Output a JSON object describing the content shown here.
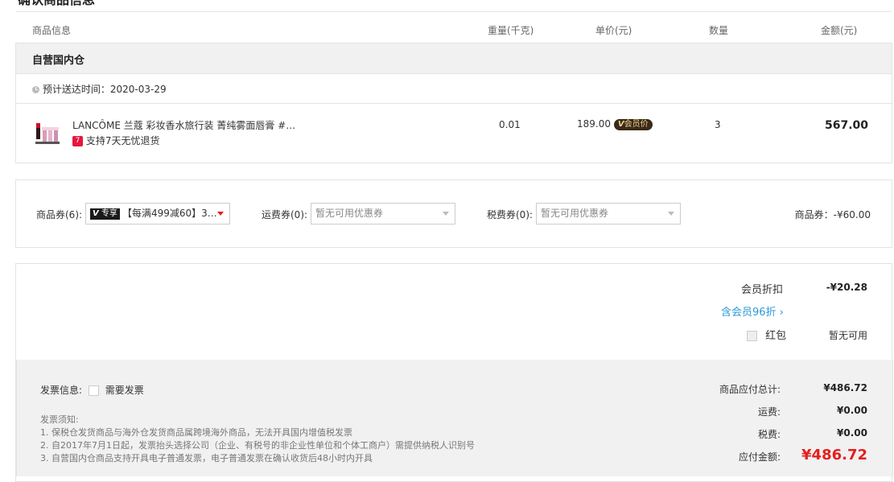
{
  "section": {
    "title": "确认商品信息"
  },
  "columns": [
    "商品信息",
    "重量(千克)",
    "单价(元)",
    "数量",
    "金额(元)"
  ],
  "warehouse": {
    "name": "自营国内仓",
    "delivery_label": "预计送达时间：",
    "delivery_date": "2020-03-29"
  },
  "item": {
    "name": "LANCÔME 兰蔻 彩妆香水旅行装 菁纯雾面唇膏 #…",
    "return_badge": "7",
    "return_text": "支持7天无忧退货",
    "weight": "0.01",
    "price": "189.00",
    "member_v": "V",
    "member_label": "会员价",
    "quantity": "3",
    "amount": "567.00"
  },
  "coupons": {
    "goods_label": "商品券(6):",
    "goods_tag_v": "V",
    "goods_tag_text": "专享",
    "goods_value": "【每满499减60】3…",
    "shipping_label": "运费券(0):",
    "shipping_value": "暂无可用优惠券",
    "tax_label": "税费券(0):",
    "tax_value": "暂无可用优惠券",
    "summary": "商品券：-¥60.00"
  },
  "discounts": {
    "member_discount_label": "会员折扣",
    "member_discount_value": "-¥20.28",
    "member_link": "含会员96折 ›",
    "red_packet_label": "红包",
    "red_packet_value": "暂无可用"
  },
  "invoice": {
    "label": "发票信息:",
    "need_label": "需要发票",
    "notice_title": "发票须知:",
    "notes": [
      "1. 保税仓发货商品与海外仓发货商品属跨境海外商品，无法开具国内增值税发票",
      "2. 自2017年7月1日起，发票抬头选择公司（企业、有税号的非企业性单位和个体工商户）需提供纳税人识别号",
      "3. 自营国内仓商品支持开具电子普通发票，电子普通发票在确认收货后48小时内开具"
    ]
  },
  "totals": {
    "subtotal_label": "商品应付总计:",
    "subtotal_value": "¥486.72",
    "shipping_label": "运费:",
    "shipping_value": "¥0.00",
    "tax_label": "税费:",
    "tax_value": "¥0.00",
    "payable_label": "应付金额:",
    "payable_value": "¥486.72"
  },
  "colors": {
    "accent_red": "#e61f1f",
    "link_blue": "#2a9bd8",
    "member_dark": "#3a2a16"
  }
}
